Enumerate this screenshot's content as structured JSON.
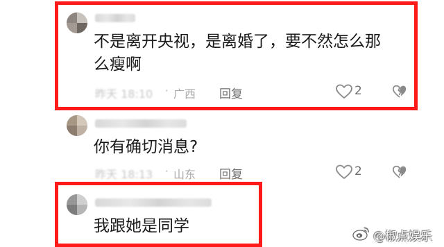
{
  "comments": [
    {
      "text_lines": [
        "不是离开央视，是离婚了，要不然怎么那",
        "么瘦啊"
      ],
      "time": "昨天 18:10",
      "separator": "·",
      "region": "广西",
      "reply_label": "回复",
      "likes": "2"
    },
    {
      "text_lines": [
        "你有确切消息?"
      ],
      "time": "昨天 18:13",
      "separator": "·",
      "region": "山东",
      "reply_label": "回复",
      "likes": "2"
    },
    {
      "text_lines": [
        "我跟她是同学"
      ]
    }
  ],
  "icons": {
    "like": "heart-outline-icon",
    "dislike": "broken-heart-icon",
    "watermark": "weibo-logo-icon"
  },
  "colors": {
    "highlight_frame": "#ff1a1a",
    "body_text": "#1a1a1a",
    "meta_text": "#a9a9a9",
    "action_text": "#6e6e6e"
  },
  "watermark": {
    "text": "@椒点娱乐"
  }
}
